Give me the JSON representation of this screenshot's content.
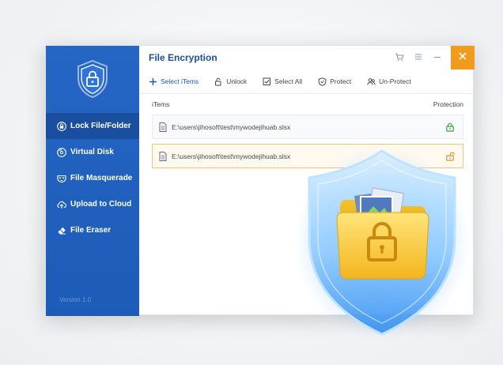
{
  "app": {
    "title": "File Encryption",
    "version": "Version 1.0"
  },
  "sidebar": {
    "items": [
      {
        "label": "Lock File/Folder",
        "icon": "lock-icon",
        "active": true
      },
      {
        "label": "Virtual Disk",
        "icon": "disk-icon",
        "active": false
      },
      {
        "label": "File Masquerade",
        "icon": "mask-icon",
        "active": false
      },
      {
        "label": "Upload to Cloud",
        "icon": "cloud-upload-icon",
        "active": false
      },
      {
        "label": "File Eraser",
        "icon": "eraser-icon",
        "active": false
      }
    ]
  },
  "titlebar": {
    "cart_icon": "cart-icon",
    "menu_icon": "menu-icon",
    "minimize_icon": "minimize-icon",
    "close_icon": "close-icon"
  },
  "toolbar": {
    "select_items": "Select iTems",
    "unlock": "Unlock",
    "select_all": "Select All",
    "protect": "Protect",
    "un_protect": "Un-Protect"
  },
  "list": {
    "col_items": "iTems",
    "col_protection": "Protection",
    "rows": [
      {
        "path": "E:\\users\\jihosoft\\test\\mywodejihuab.slsx",
        "protection": "locked",
        "selected": false
      },
      {
        "path": "E:\\users\\jihosoft\\test\\mywodejihuab.slsx",
        "protection": "unlocked",
        "selected": true
      }
    ]
  },
  "colors": {
    "sidebar": "#1f5fbe",
    "accent": "#1c4fa3",
    "close": "#f29a1c",
    "locked": "#3aa53a",
    "unlocked": "#e5942a"
  }
}
